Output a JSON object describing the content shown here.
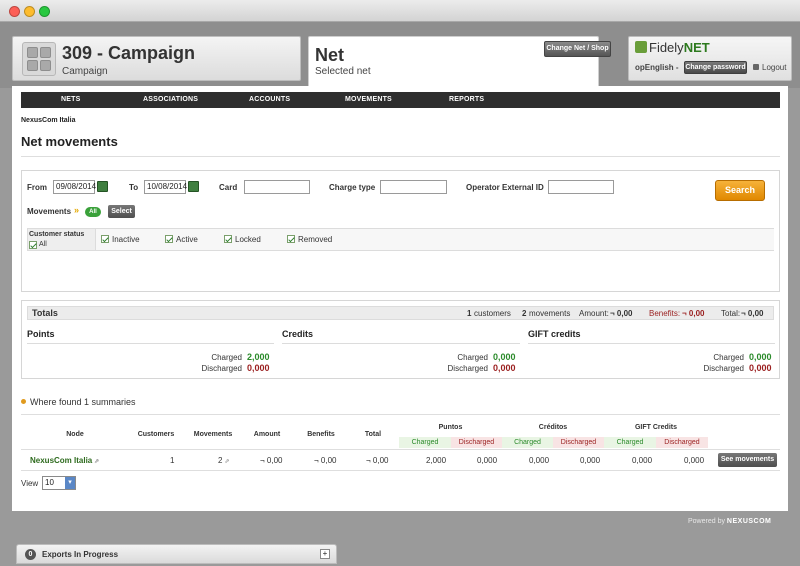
{
  "campaign": {
    "title": "309 - Campaign",
    "subtitle": "Campaign"
  },
  "net": {
    "title": "Net",
    "subtitle": "Selected net",
    "change_label": "Change Net / Shop"
  },
  "user": {
    "logo_prefix": "Fidely",
    "logo_suffix": "NET",
    "name": "opEnglish -",
    "change_password_label": "Change password",
    "logout_label": "Logout"
  },
  "nav": {
    "items": [
      "NETS",
      "ASSOCIATIONS",
      "ACCOUNTS",
      "MOVEMENTS",
      "REPORTS"
    ]
  },
  "breadcrumb": "NexusCom Italia",
  "page_title": "Net movements",
  "filters": {
    "from_label": "From",
    "from_value": "09/08/2014",
    "to_label": "To",
    "to_value": "10/08/2014",
    "card_label": "Card",
    "card_value": "",
    "charge_type_label": "Charge type",
    "charge_type_value": "",
    "operator_label": "Operator External ID",
    "operator_value": "",
    "movements_label": "Movements",
    "movements_all": "All",
    "select_label": "Select",
    "customer_status_label": "Customer status",
    "all_label": "All",
    "status_options": [
      "Inactive",
      "Active",
      "Locked",
      "Removed"
    ],
    "search_label": "Search"
  },
  "totals": {
    "label": "Totals",
    "customers_count": "1",
    "customers_label": "customers",
    "movements_count": "2",
    "movements_label": "movements",
    "amount_label": "Amount:",
    "amount_value": "¬ 0,00",
    "benefits_label": "Benefits:",
    "benefits_value": "¬ 0,00",
    "total_label": "Total:",
    "total_value": "¬ 0,00",
    "points": {
      "title": "Points",
      "charged_label": "Charged",
      "charged": "2,000",
      "discharged_label": "Discharged",
      "discharged": "0,000"
    },
    "credits": {
      "title": "Credits",
      "charged_label": "Charged",
      "charged": "0,000",
      "discharged_label": "Discharged",
      "discharged": "0,000"
    },
    "gift": {
      "title": "GIFT credits",
      "charged_label": "Charged",
      "charged": "0,000",
      "discharged_label": "Discharged",
      "discharged": "0,000"
    }
  },
  "summaries_text": "Where found 1 summaries",
  "table": {
    "headers": {
      "node": "Node",
      "customers": "Customers",
      "movements": "Movements",
      "amount": "Amount",
      "benefits": "Benefits",
      "total": "Total",
      "puntos": "Puntos",
      "creditos": "Créditos",
      "gift": "GIFT Credits"
    },
    "sub_headers": {
      "charged": "Charged",
      "discharged": "Discharged"
    },
    "rows": [
      {
        "node": "NexusCom Italia",
        "customers": "1",
        "movements": "2",
        "amount": "¬ 0,00",
        "benefits": "¬ 0,00",
        "total": "¬ 0,00",
        "puntos_charged": "2,000",
        "puntos_discharged": "0,000",
        "creditos_charged": "0,000",
        "creditos_discharged": "0,000",
        "gift_charged": "0,000",
        "gift_discharged": "0,000",
        "action_label": "See movements"
      }
    ]
  },
  "view": {
    "label": "View",
    "value": "10"
  },
  "powered_by": {
    "prefix": "Powered by",
    "brand": "NEXUSCOM"
  },
  "exports": {
    "count": "0",
    "label": "Exports In Progress"
  },
  "colors": {
    "accent": "#e08800",
    "nav": "#2e2e2e",
    "positive": "#2a8a2a",
    "negative": "#9a1e1e"
  }
}
